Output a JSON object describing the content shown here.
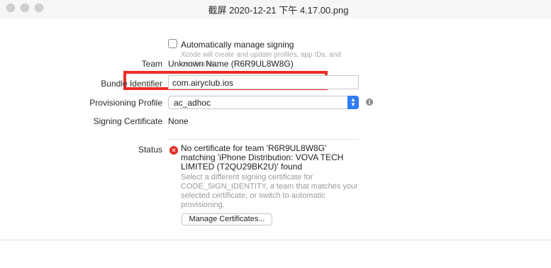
{
  "window": {
    "title": "截屏 2020-12-21 下午 4.17.00.png"
  },
  "signing": {
    "auto_manage_label": "Automatically manage signing",
    "auto_manage_checked": false,
    "auto_manage_help": "Xcode will create and update profiles, app IDs, and certificates."
  },
  "team": {
    "label": "Team",
    "value": "Unknown Name (R6R9UL8W8G)",
    "highlight_color": "#ee2b26"
  },
  "bundle": {
    "label": "Bundle Identifier",
    "value": "com.airyclub.ios"
  },
  "provisioning": {
    "label": "Provisioning Profile",
    "selected": "ac_adhoc"
  },
  "certificate": {
    "label": "Signing Certificate",
    "value": "None"
  },
  "status": {
    "label": "Status",
    "error": "No certificate for team 'R6R9UL8W8G' matching 'iPhone Distribution: VOVA TECH LIMITED (T2QU29BK2U)' found",
    "help": "Select a different signing certificate for CODE_SIGN_IDENTITY, a team that matches your selected certificate, or switch to automatic provisioning.",
    "error_color": "#e02a24",
    "manage_button": "Manage Certificates..."
  },
  "colors": {
    "accent": "#2f7bf5"
  }
}
